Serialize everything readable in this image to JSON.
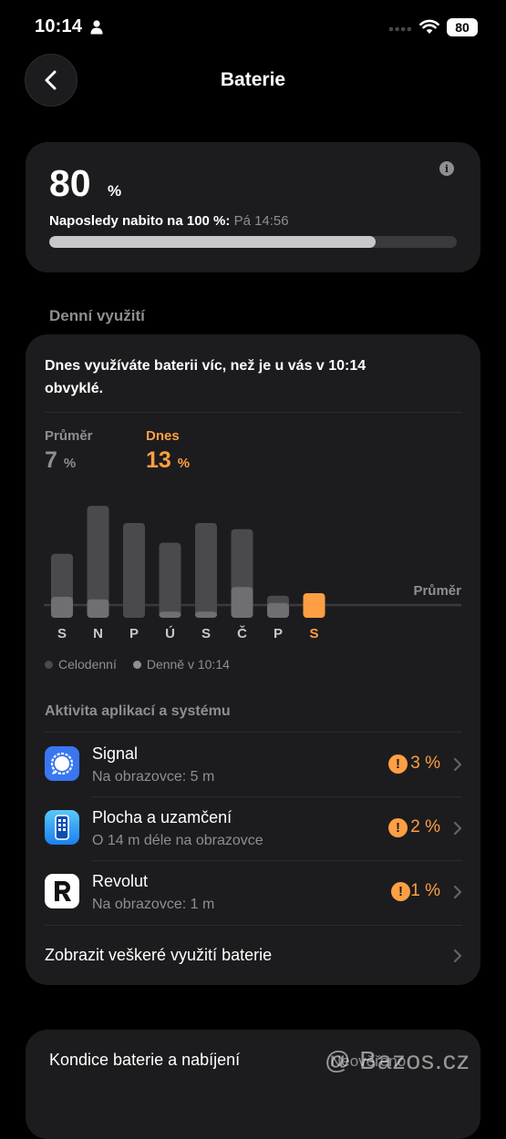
{
  "status_bar": {
    "time": "10:14",
    "battery": "80"
  },
  "header": {
    "title": "Baterie"
  },
  "battery_card": {
    "level": "80",
    "unit": "%",
    "last_charged_label": "Naposledy nabito na 100 %:",
    "last_charged_time": "Pá 14:56",
    "level_fraction": 0.8
  },
  "daily_usage": {
    "section_title": "Denní využití",
    "notice": "Dnes využíváte baterii víc, než je u vás v 10:14 obvyklé.",
    "average": {
      "label": "Průměr",
      "value": "7",
      "unit": "%"
    },
    "today": {
      "label": "Dnes",
      "value": "13",
      "unit": "%"
    },
    "chart_data": {
      "type": "bar",
      "categories": [
        "S",
        "N",
        "P",
        "Ú",
        "S",
        "Č",
        "P",
        "S"
      ],
      "series": [
        {
          "name": "Celodenní",
          "values": [
            52,
            91,
            77,
            61,
            77,
            72,
            18,
            0
          ]
        },
        {
          "name": "Denně v 10:14",
          "values": [
            17,
            15,
            0,
            5,
            5,
            25,
            12,
            20
          ]
        }
      ],
      "average_label": "Průměr",
      "highlight_index": 7,
      "colors": {
        "full_day": "#4a4a4e",
        "by_time": "#6e6e73",
        "today": "#ff9f43",
        "average_line": "#3a3a3c"
      }
    },
    "legend": {
      "full_day": "Celodenní",
      "by_time": "Denně v 10:14"
    },
    "apps_title": "Aktivita aplikací a systému",
    "apps": [
      {
        "name": "Signal",
        "detail": "Na obrazovce: 5 m",
        "percent": "3 %",
        "icon": "signal-icon"
      },
      {
        "name": "Plocha a uzamčení",
        "detail": "O 14 m déle na obrazovce",
        "percent": "2 %",
        "icon": "home-lock-screen-icon"
      },
      {
        "name": "Revolut",
        "detail": "Na obrazovce: 1 m",
        "percent": "1 %",
        "icon": "revolut-icon"
      }
    ],
    "show_all": "Zobrazit veškeré využití baterie"
  },
  "health": {
    "label": "Kondice baterie a nabíjení",
    "status": "Neověřeno"
  },
  "watermark": "@ Bazos.cz",
  "colors": {
    "accent": "#ff9f43",
    "card": "#1c1c1e",
    "muted": "#8e8e93"
  }
}
